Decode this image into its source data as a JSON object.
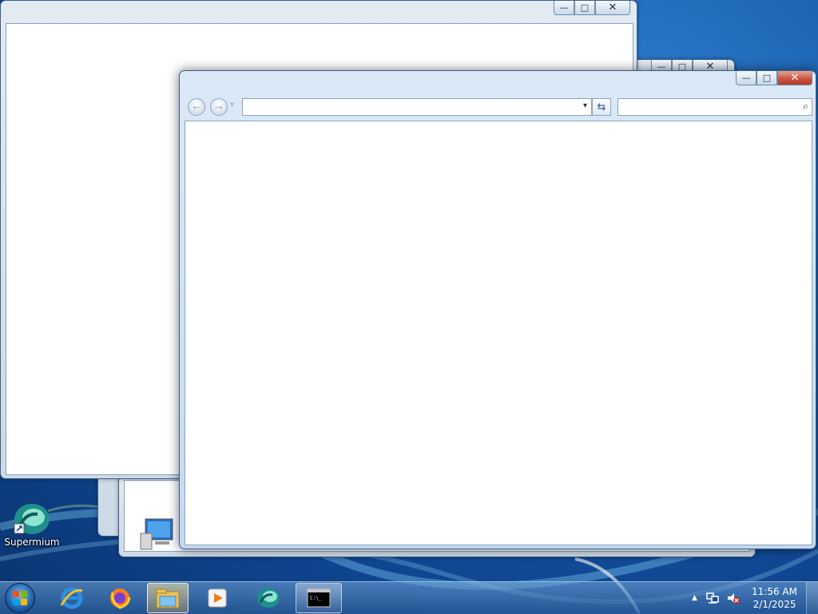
{
  "desktop": {
    "icons": [
      {
        "label": "Supermium",
        "icon": "supermium-icon"
      }
    ]
  },
  "windows": {
    "back_window": {
      "controls": {
        "minimize": "—",
        "maximize": "□",
        "close": "✕"
      }
    },
    "middle_window": {
      "controls": {
        "minimize": "—",
        "maximize": "□",
        "close": "✕"
      }
    },
    "explorer_window": {
      "controls": {
        "minimize": "—",
        "maximize": "□",
        "close": "✕"
      },
      "nav": {
        "back_icon": "←",
        "forward_icon": "→",
        "recent_icon": "▾"
      },
      "address_bar": {
        "value": "",
        "dropdown_icon": "▾"
      },
      "refresh_icon": "⇆",
      "search_box": {
        "placeholder": "",
        "icon": "⌕"
      }
    }
  },
  "taskbar": {
    "start_button": "start-orb",
    "pinned": [
      {
        "name": "internet-explorer-icon"
      },
      {
        "name": "firefox-icon"
      },
      {
        "name": "windows-explorer-icon",
        "active": true
      },
      {
        "name": "media-player-icon"
      },
      {
        "name": "supermium-icon"
      },
      {
        "name": "command-prompt-icon"
      }
    ],
    "tray": {
      "overflow_icon": "▲",
      "network_icon": "network-icon",
      "volume_icon": "volume-muted-icon",
      "time": "11:56 AM",
      "date": "2/1/2025"
    }
  },
  "colors": {
    "desktop_blue": "#1a5fae",
    "close_red": "#c75846",
    "window_frame": "#c3d8ef"
  }
}
